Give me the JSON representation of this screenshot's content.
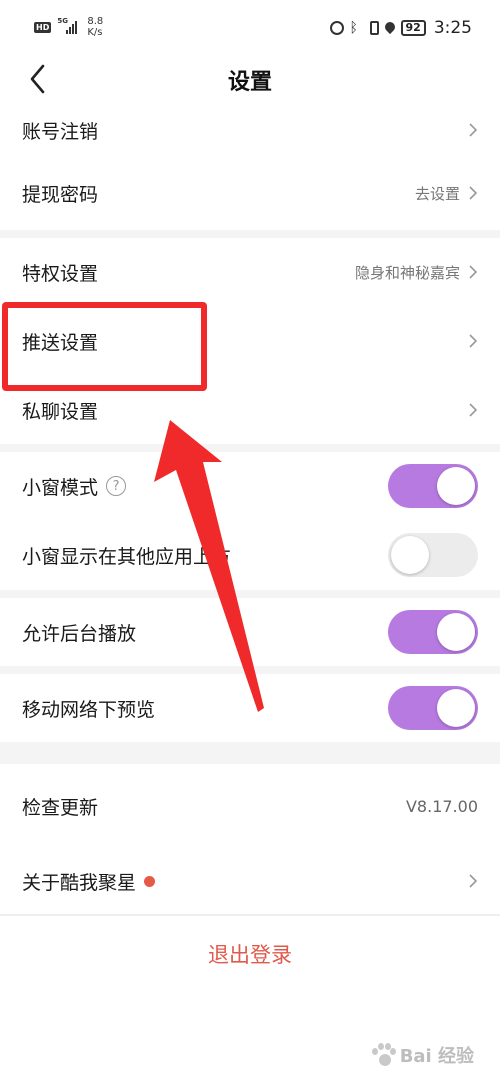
{
  "status_bar": {
    "hd": "HD",
    "network": "5G",
    "speed_value": "8.8",
    "speed_unit": "K/s",
    "battery": "92",
    "time": "3:25"
  },
  "header": {
    "title": "设置"
  },
  "rows": {
    "account_cancel": {
      "label": "账号注销"
    },
    "withdraw_password": {
      "label": "提现密码",
      "value": "去设置"
    },
    "privilege": {
      "label": "特权设置",
      "value": "隐身和神秘嘉宾"
    },
    "push": {
      "label": "推送设置"
    },
    "private_chat": {
      "label": "私聊设置"
    },
    "small_window": {
      "label": "小窗模式",
      "help": "?",
      "on": true
    },
    "small_window_overlay": {
      "label": "小窗显示在其他应用上方",
      "on": false
    },
    "background_play": {
      "label": "允许后台播放",
      "on": true
    },
    "mobile_preview": {
      "label": "移动网络下预览",
      "on": true
    },
    "check_update": {
      "label": "检查更新",
      "value": "V8.17.00"
    },
    "about": {
      "label": "关于酷我聚星"
    }
  },
  "logout": {
    "label": "退出登录"
  },
  "watermark": {
    "text": "Bai 经验"
  },
  "colors": {
    "toggle_on": "#b67ae0",
    "toggle_off": "#ececec",
    "logout_text": "#e05a4b",
    "annotation_red": "#f02a2a",
    "notification_dot": "#e55a47"
  }
}
